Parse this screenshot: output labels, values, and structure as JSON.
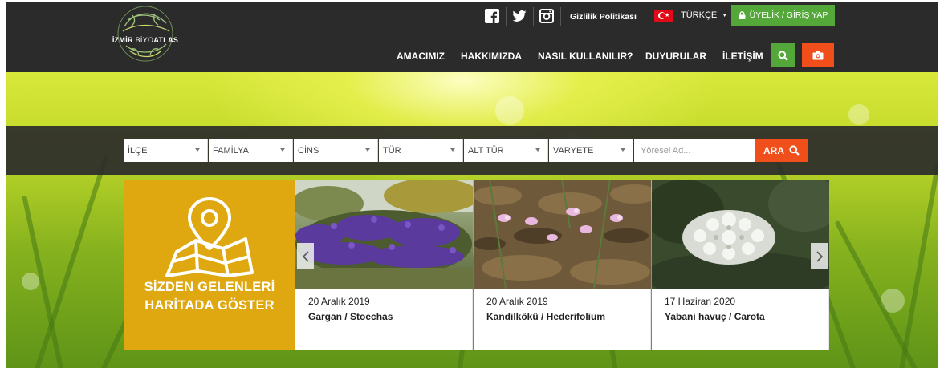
{
  "header": {
    "logo": {
      "word_bold": "İZMİR",
      "word_thin": "BİYO",
      "word_rest": "ATLAS"
    },
    "social_icons": [
      "facebook-icon",
      "twitter-icon",
      "instagram-icon"
    ],
    "privacy_label": "Gizlilik Politikası",
    "language_label": "TÜRKÇE",
    "login_label": "ÜYELİK / GİRİŞ YAP",
    "nav": [
      {
        "label": "AMACIMIZ"
      },
      {
        "label": "HAKKIMIZDA"
      },
      {
        "label": "NASIL KULLANILIR?"
      },
      {
        "label": "DUYURULAR"
      },
      {
        "label": "İLETİŞİM"
      }
    ]
  },
  "filters": {
    "selects": [
      {
        "label": "İLÇE"
      },
      {
        "label": "FAMİLYA"
      },
      {
        "label": "CİNS"
      },
      {
        "label": "TÜR"
      },
      {
        "label": "ALT TÜR"
      },
      {
        "label": "VARYETE"
      }
    ],
    "local_name_placeholder": "Yöresel Ad...",
    "local_name_value": "",
    "search_label": "ARA"
  },
  "map_tile": {
    "line1": "SİZDEN GELENLERİ",
    "line2": "HARİTADA GÖSTER"
  },
  "cards": [
    {
      "date": "20 Aralık 2019",
      "name": "Gargan / Stoechas"
    },
    {
      "date": "20 Aralık 2019",
      "name": "Kandilkökü / Hederifolium"
    },
    {
      "date": "17 Haziran 2020",
      "name": "Yabani havuç / Carota"
    }
  ],
  "colors": {
    "accent_green": "#54a83a",
    "accent_orange": "#f04e1a",
    "map_tile": "#dfa810",
    "header_bg": "#2b2b2b"
  }
}
